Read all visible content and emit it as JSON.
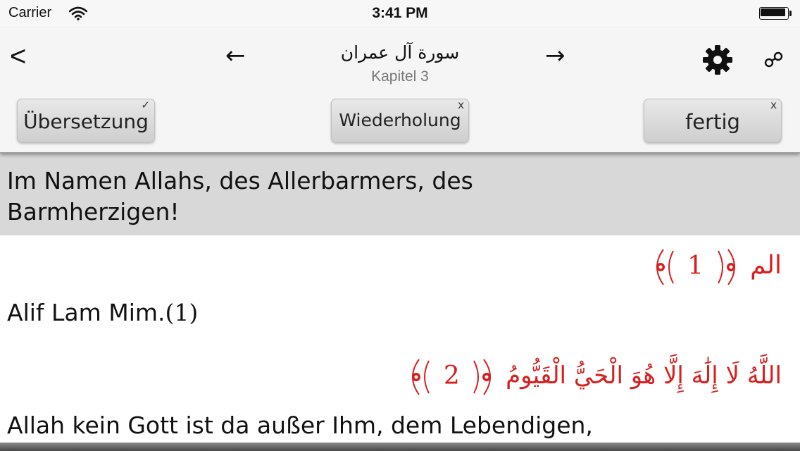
{
  "status_bar": {
    "carrier": "Carrier",
    "time": "3:41 PM"
  },
  "nav": {
    "back_label": "<",
    "prev_label": "←",
    "next_label": "→",
    "title": "سورة آل عمران",
    "subtitle": "Kapitel 3"
  },
  "toolbar": {
    "translation_label": "Übersetzung",
    "translation_mark": "✓",
    "repeat_label": "Wiederholung",
    "repeat_mark": "x",
    "done_label": "fertig",
    "done_mark": "x"
  },
  "content": {
    "basmala_translation": "Im Namen Allahs, des Allerbarmers, des Barmherzigen!",
    "verses": [
      {
        "number": "1",
        "arabic": "الم",
        "translation": "Alif Lam Mim.",
        "inline_marker": "(1)"
      },
      {
        "number": "2",
        "arabic": "اللَّهُ لَا إِلَٰهَ إِلَّا هُوَ الْحَيُّ الْقَيُّومُ",
        "translation": "Allah kein Gott ist da außer Ihm, dem Lebendigen,"
      }
    ]
  },
  "colors": {
    "arabic_text": "#d62020",
    "highlight_row": "#d8d8d8",
    "nav_background": "#f5f5f5"
  }
}
